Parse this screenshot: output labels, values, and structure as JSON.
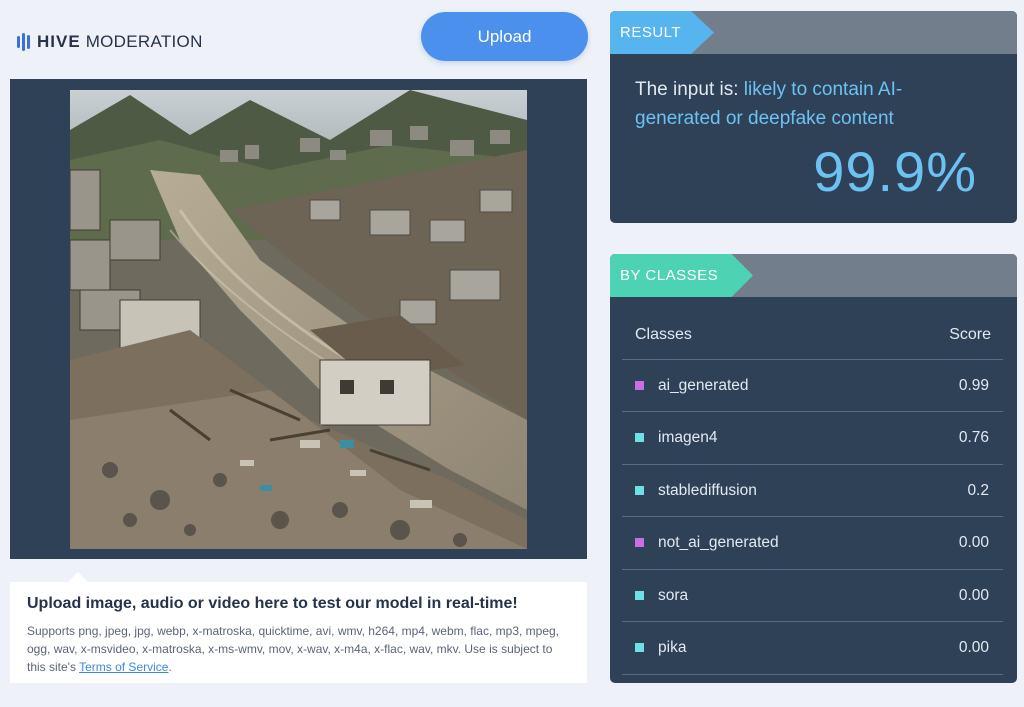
{
  "header": {
    "logo_bold": "HIVE",
    "logo_light": "MODERATION",
    "upload_label": "Upload"
  },
  "upload_info": {
    "title": "Upload image, audio or video here to test our model in real-time!",
    "text": "Supports png, jpeg, jpg, webp, x-matroska, quicktime, avi, wmv, h264, mp4, webm, flac, mp3, mpeg, ogg, wav, x-msvideo, x-matroska, x-ms-wmv, mov, x-wav, x-m4a, x-flac, wav, mkv. Use is subject to this site's ",
    "tos_link": "Terms of Service",
    "tos_suffix": "."
  },
  "result": {
    "tag": "RESULT",
    "prefix": "The input is: ",
    "verdict": "likely to contain AI-generated or deepfake content",
    "percent": "99.9%"
  },
  "classes": {
    "tag": "BY CLASSES",
    "col_class": "Classes",
    "col_score": "Score",
    "rows": [
      {
        "name": "ai_generated",
        "score": "0.99",
        "color": "#c86fe6"
      },
      {
        "name": "imagen4",
        "score": "0.76",
        "color": "#6fe0e6"
      },
      {
        "name": "stablediffusion",
        "score": "0.2",
        "color": "#6fe0e6"
      },
      {
        "name": "not_ai_generated",
        "score": "0.00",
        "color": "#c86fe6"
      },
      {
        "name": "sora",
        "score": "0.00",
        "color": "#6fe0e6"
      },
      {
        "name": "pika",
        "score": "0.00",
        "color": "#6fe0e6"
      }
    ]
  },
  "colors": {
    "accent_blue": "#4a90ec",
    "panel_navy": "#2e4157",
    "result_tag": "#56b4ef",
    "classes_tag": "#4ed2b4"
  }
}
